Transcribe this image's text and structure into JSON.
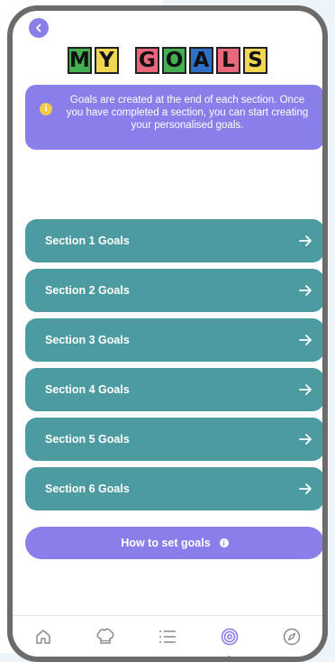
{
  "title": {
    "words": [
      [
        {
          "letter": "M",
          "color": "#45b050"
        },
        {
          "letter": "Y",
          "color": "#f2d653"
        }
      ],
      [
        {
          "letter": "G",
          "color": "#e8687b"
        },
        {
          "letter": "O",
          "color": "#45b050"
        },
        {
          "letter": "A",
          "color": "#2f6fc8"
        },
        {
          "letter": "L",
          "color": "#e8687b"
        },
        {
          "letter": "S",
          "color": "#f2d653"
        }
      ]
    ]
  },
  "info": {
    "text": "Goals are created at the end of each section. Once you have completed a section, you can start creating your personalised goals.",
    "icon_glyph": "i"
  },
  "sections": [
    {
      "label": "Section 1 Goals"
    },
    {
      "label": "Section 2 Goals"
    },
    {
      "label": "Section 3 Goals"
    },
    {
      "label": "Section 4 Goals"
    },
    {
      "label": "Section 5 Goals"
    },
    {
      "label": "Section 6 Goals"
    }
  ],
  "howto": {
    "label": "How to set goals",
    "icon_glyph": "i"
  },
  "tabs": [
    {
      "icon": "home-icon",
      "active": false
    },
    {
      "icon": "chef-hat-icon",
      "active": false
    },
    {
      "icon": "list-icon",
      "active": false
    },
    {
      "icon": "target-icon",
      "active": true
    },
    {
      "icon": "compass-icon",
      "active": false
    }
  ],
  "colors": {
    "accent": "#8a7fea",
    "section": "#4b9ba0"
  }
}
